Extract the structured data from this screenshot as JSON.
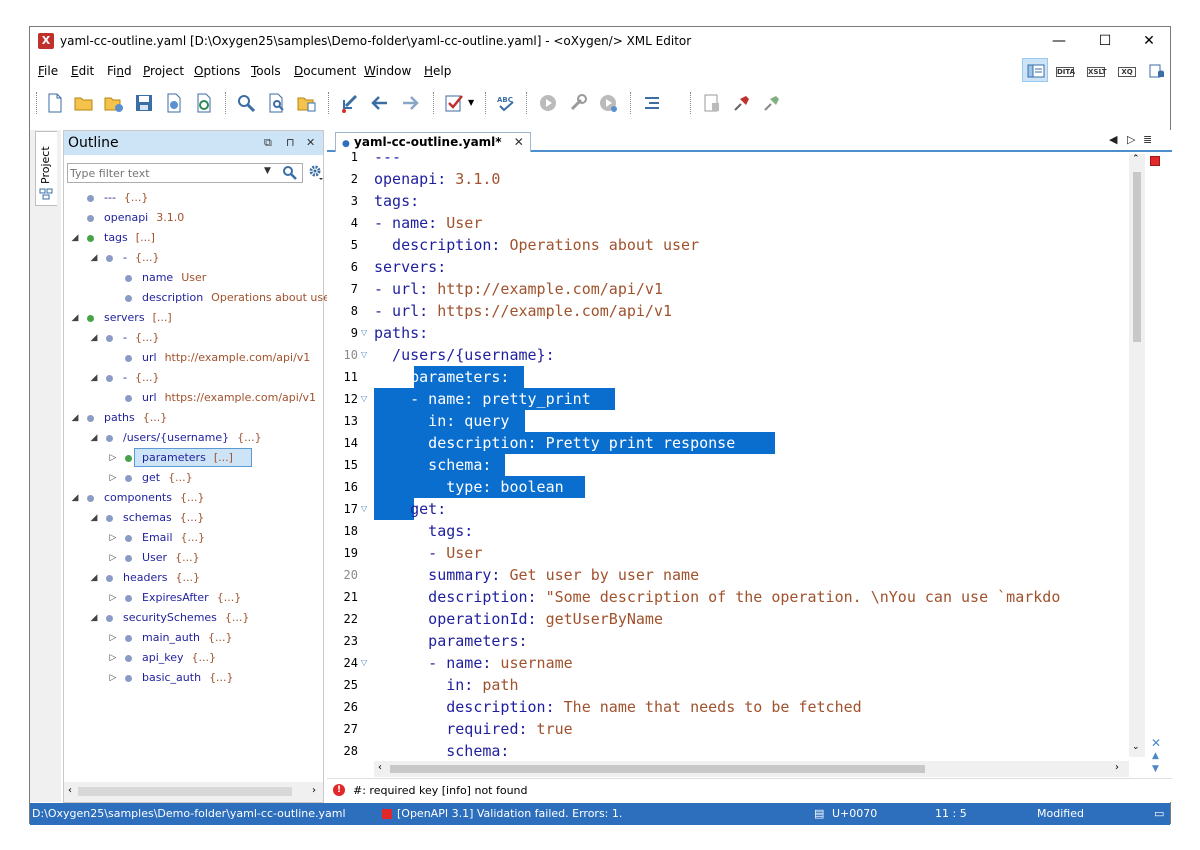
{
  "window": {
    "title": "yaml-cc-outline.yaml [D:\\Oxygen25\\samples\\Demo-folder\\yaml-cc-outline.yaml] - <oXygen/> XML Editor",
    "icon": "oxygen-app-icon",
    "minimize": "—",
    "maximize": "☐",
    "close": "✕"
  },
  "menu": [
    {
      "label": "File",
      "ul": "F",
      "rest": "ile"
    },
    {
      "label": "Edit",
      "ul": "E",
      "rest": "dit"
    },
    {
      "label": "Find",
      "pre": "Fi",
      "ul": "n",
      "rest": "d"
    },
    {
      "label": "Project",
      "ul": "P",
      "rest": "roject"
    },
    {
      "label": "Options",
      "ul": "O",
      "rest": "ptions"
    },
    {
      "label": "Tools",
      "ul": "T",
      "rest": "ools"
    },
    {
      "label": "Document",
      "ul": "D",
      "rest": "ocument"
    },
    {
      "label": "Window",
      "ul": "W",
      "rest": "indow"
    },
    {
      "label": "Help",
      "ul": "H",
      "rest": "elp"
    }
  ],
  "perspectives": [
    {
      "name": "editor-perspective",
      "label": ""
    },
    {
      "name": "dita-perspective",
      "label": "DITA"
    },
    {
      "name": "xslt-perspective",
      "label": "XSLT"
    },
    {
      "name": "xquery-perspective",
      "label": "XQ"
    },
    {
      "name": "database-perspective",
      "label": ""
    }
  ],
  "side": {
    "project_label": "Project"
  },
  "outline": {
    "title": "Outline",
    "filter_placeholder": "Type filter text",
    "buttons": {
      "float": "⧉",
      "pin": "⊓",
      "close": "✕"
    },
    "tree": [
      {
        "key": "---",
        "val": "{...}",
        "dot": "blue",
        "twisty": ""
      },
      {
        "key": "openapi",
        "val": "3.1.0",
        "dot": "blue",
        "twisty": ""
      },
      {
        "key": "tags",
        "val": "[...]",
        "dot": "green",
        "twisty": "◢"
      },
      {
        "key": "-",
        "val": "{...}",
        "dot": "blue",
        "twisty": "◢"
      },
      {
        "key": "name",
        "val": "User",
        "dot": "blue",
        "twisty": ""
      },
      {
        "key": "description",
        "val": "Operations about user",
        "dot": "blue",
        "twisty": ""
      },
      {
        "key": "servers",
        "val": "[...]",
        "dot": "green",
        "twisty": "◢"
      },
      {
        "key": "-",
        "val": "{...}",
        "dot": "blue",
        "twisty": "◢"
      },
      {
        "key": "url",
        "val": "http://example.com/api/v1",
        "dot": "blue",
        "twisty": ""
      },
      {
        "key": "-",
        "val": "{...}",
        "dot": "blue",
        "twisty": "◢"
      },
      {
        "key": "url",
        "val": "https://example.com/api/v1",
        "dot": "blue",
        "twisty": ""
      },
      {
        "key": "paths",
        "val": "{...}",
        "dot": "blue",
        "twisty": "◢"
      },
      {
        "key": "/users/{username}",
        "val": "{...}",
        "dot": "blue",
        "twisty": "◢"
      },
      {
        "key": "parameters",
        "val": "[...]",
        "dot": "green",
        "twisty": "▷",
        "selected": true
      },
      {
        "key": "get",
        "val": "{...}",
        "dot": "blue",
        "twisty": "▷"
      },
      {
        "key": "components",
        "val": "{...}",
        "dot": "blue",
        "twisty": "◢"
      },
      {
        "key": "schemas",
        "val": "{...}",
        "dot": "blue",
        "twisty": "◢"
      },
      {
        "key": "Email",
        "val": "{...}",
        "dot": "blue",
        "twisty": "▷"
      },
      {
        "key": "User",
        "val": "{...}",
        "dot": "blue",
        "twisty": "▷"
      },
      {
        "key": "headers",
        "val": "{...}",
        "dot": "blue",
        "twisty": "◢"
      },
      {
        "key": "ExpiresAfter",
        "val": "{...}",
        "dot": "blue",
        "twisty": "▷"
      },
      {
        "key": "securitySchemes",
        "val": "{...}",
        "dot": "blue",
        "twisty": "◢"
      },
      {
        "key": "main_auth",
        "val": "{...}",
        "dot": "blue",
        "twisty": "▷"
      },
      {
        "key": "api_key",
        "val": "{...}",
        "dot": "blue",
        "twisty": "▷"
      },
      {
        "key": "basic_auth",
        "val": "{...}",
        "dot": "blue",
        "twisty": "▷"
      }
    ]
  },
  "editor": {
    "tab_label": "yaml-cc-outline.yaml*",
    "tab_close": "✕",
    "line_numbers": [
      "1",
      "2",
      "3",
      "4",
      "5",
      "6",
      "7",
      "8",
      "9",
      "10",
      "11",
      "12",
      "13",
      "14",
      "15",
      "16",
      "17",
      "18",
      "19",
      "20",
      "21",
      "22",
      "23",
      "24",
      "25",
      "26",
      "27",
      "28"
    ],
    "lines": [
      {
        "k": "---",
        "v": ""
      },
      {
        "k": "openapi:",
        "v": " 3.1.0"
      },
      {
        "k": "tags:",
        "v": ""
      },
      {
        "k": "- name:",
        "v": " User"
      },
      {
        "k": "  description:",
        "v": " Operations about user"
      },
      {
        "k": "servers:",
        "v": ""
      },
      {
        "k": "- url:",
        "v": " http://example.com/api/v1"
      },
      {
        "k": "- url:",
        "v": " https://example.com/api/v1"
      },
      {
        "k": "paths:",
        "v": ""
      },
      {
        "k": "  /users/{username}:",
        "v": ""
      },
      {
        "k": "    parameters:",
        "v": ""
      },
      {
        "k": "    - name:",
        "v": " pretty_print"
      },
      {
        "k": "      in:",
        "v": " query"
      },
      {
        "k": "      description:",
        "v": " Pretty print response"
      },
      {
        "k": "      schema:",
        "v": ""
      },
      {
        "k": "        type:",
        "v": " boolean"
      },
      {
        "k": "    get:",
        "v": ""
      },
      {
        "k": "      tags:",
        "v": ""
      },
      {
        "k": "      -",
        "v": " User"
      },
      {
        "k": "      summary:",
        "v": " Get user by user name"
      },
      {
        "k": "      description:",
        "v": " \"Some description of the operation. \\nYou can use `markdo"
      },
      {
        "k": "      operationId:",
        "v": " getUserByName"
      },
      {
        "k": "      parameters:",
        "v": ""
      },
      {
        "k": "      - name:",
        "v": " username"
      },
      {
        "k": "        in:",
        "v": " path"
      },
      {
        "k": "        description:",
        "v": " The name that needs to be fetched"
      },
      {
        "k": "        required:",
        "v": " true"
      },
      {
        "k": "        schema:",
        "v": ""
      }
    ]
  },
  "problems": {
    "message": "#: required key [info] not found"
  },
  "status": {
    "path": "D:\\Oxygen25\\samples\\Demo-folder\\yaml-cc-outline.yaml",
    "validation": "[OpenAPI 3.1] Validation failed. Errors: 1.",
    "unicode": "U+0070",
    "position": "11 : 5",
    "state": "Modified"
  },
  "colors": {
    "accent": "#2d6fbd",
    "selection": "#0a6ecf",
    "key": "#1f1f9e",
    "value": "#a0522d",
    "error": "#e0282b"
  }
}
